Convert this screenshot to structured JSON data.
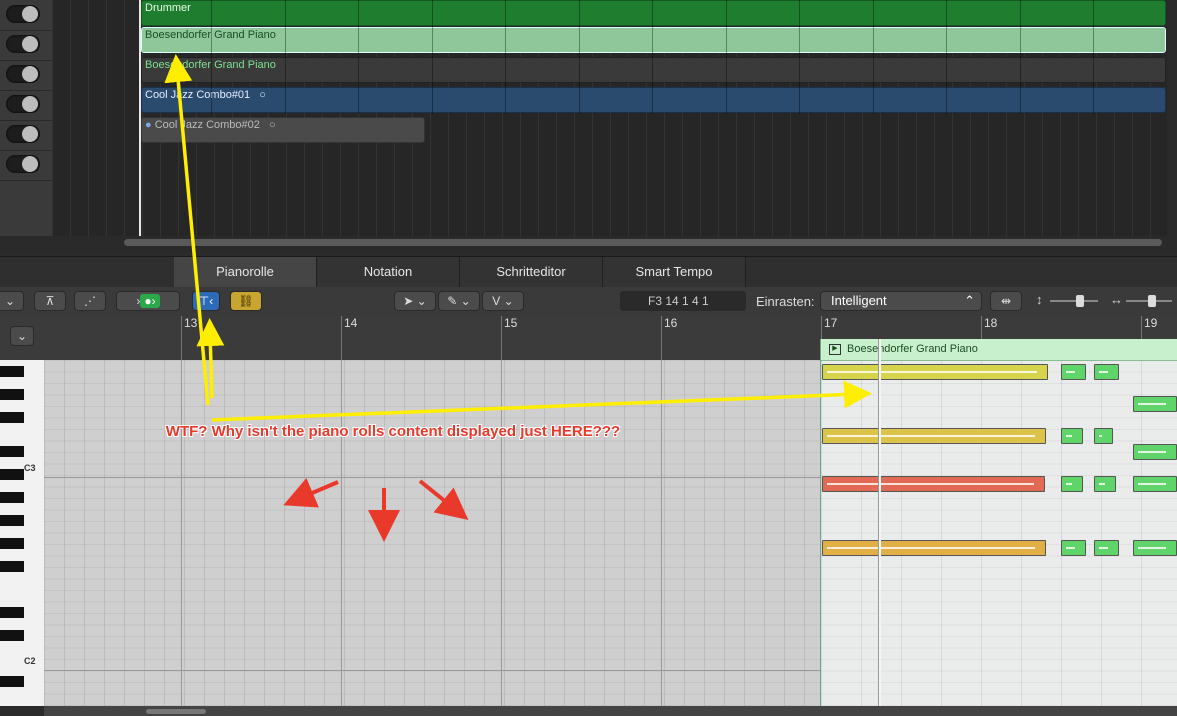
{
  "tracks": [
    {
      "name": "Drummer",
      "color": "#1f7d2f"
    },
    {
      "name": "Boesendorfer Grand Piano",
      "color": "#8fc69a"
    },
    {
      "name": "Boesendorfer Grand Piano",
      "color": "#3d3d3d"
    },
    {
      "name": "Cool Jazz Combo#01",
      "color": "#2a4a6e"
    },
    {
      "name": "Cool Jazz Combo#02",
      "color": "#4a4a4a"
    }
  ],
  "tabs": [
    "Pianorolle",
    "Notation",
    "Schritteditor",
    "Smart Tempo"
  ],
  "toolbar": {
    "position": "F3   14 1 4 1",
    "snap_label": "Einrasten:",
    "snap_value": "Intelligent",
    "v_label": "V"
  },
  "ruler": {
    "bars": [
      "13",
      "14",
      "15",
      "16",
      "17",
      "18",
      "19"
    ]
  },
  "keys": {
    "c3": "C3",
    "c2": "C2"
  },
  "region": {
    "name": "Boesendorfer Grand Piano"
  },
  "annotation": {
    "text": "WTF? Why isn't the piano rolls content displayed just HERE???"
  },
  "colors": {
    "annotation_text": "#e8392b",
    "arrow_yellow": "#ffee00",
    "arrow_red": "#e8392b"
  }
}
